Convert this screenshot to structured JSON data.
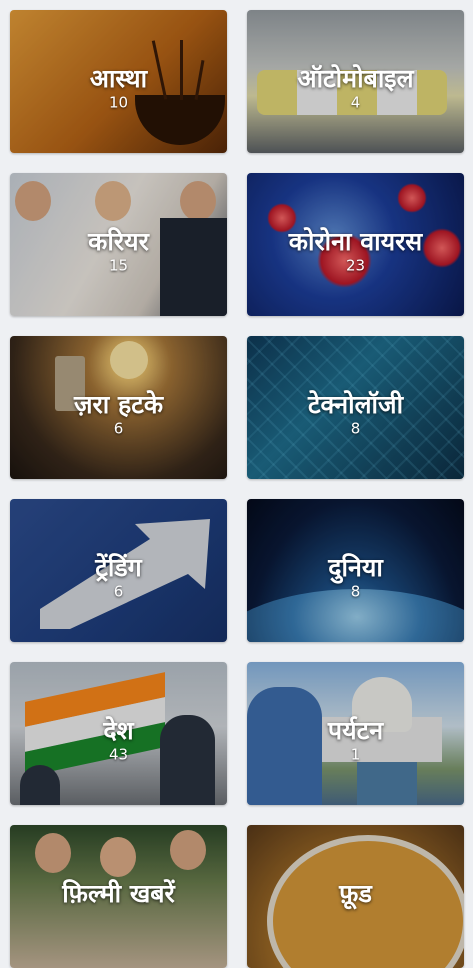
{
  "categories": [
    {
      "title": "आस्था",
      "count": "10"
    },
    {
      "title": "ऑटोमोबाइल",
      "count": "4"
    },
    {
      "title": "करियर",
      "count": "15"
    },
    {
      "title": "कोरोना वायरस",
      "count": "23"
    },
    {
      "title": "ज़रा हटके",
      "count": "6"
    },
    {
      "title": "टेक्नोलॉजी",
      "count": "8"
    },
    {
      "title": "ट्रेंडिंग",
      "count": "6"
    },
    {
      "title": "दुनिया",
      "count": "8"
    },
    {
      "title": "देश",
      "count": "43"
    },
    {
      "title": "पर्यटन",
      "count": "1"
    },
    {
      "title": "फ़िल्मी खबरें",
      "count": ""
    },
    {
      "title": "फ़ूड",
      "count": ""
    }
  ],
  "colors": {
    "background": "#eef0f3",
    "text": "#ffffff"
  }
}
